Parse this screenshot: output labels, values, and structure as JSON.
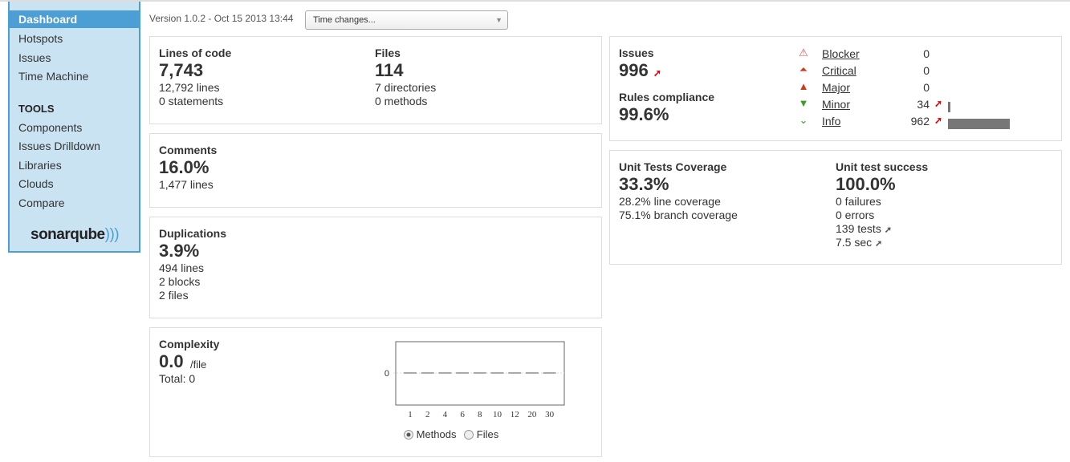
{
  "sidebar": {
    "items": [
      {
        "label": "Dashboard",
        "selected": true
      },
      {
        "label": "Hotspots"
      },
      {
        "label": "Issues"
      },
      {
        "label": "Time Machine"
      }
    ],
    "tools_heading": "TOOLS",
    "tools": [
      {
        "label": "Components"
      },
      {
        "label": "Issues Drilldown"
      },
      {
        "label": "Libraries"
      },
      {
        "label": "Clouds"
      },
      {
        "label": "Compare"
      }
    ],
    "logo": "sonarqube"
  },
  "header": {
    "version": "Version 1.0.2 - Oct 15 2013 13:44",
    "time_changes": "Time changes..."
  },
  "size": {
    "loc_label": "Lines of code",
    "loc": "7,743",
    "lines": "12,792 lines",
    "statements": "0 statements",
    "files_label": "Files",
    "files": "114",
    "directories": "7 directories",
    "methods": "0 methods"
  },
  "comments": {
    "label": "Comments",
    "value": "16.0%",
    "lines": "1,477 lines"
  },
  "duplications": {
    "label": "Duplications",
    "value": "3.9%",
    "lines": "494 lines",
    "blocks": "2 blocks",
    "files": "2 files"
  },
  "complexity": {
    "label": "Complexity",
    "value": "0.0",
    "unit": "/file",
    "total": "Total: 0",
    "radio_methods": "Methods",
    "radio_files": "Files",
    "selected": "Methods"
  },
  "chart_data": {
    "type": "bar",
    "categories": [
      "1",
      "2",
      "4",
      "6",
      "8",
      "10",
      "12",
      "20",
      "30"
    ],
    "values": [
      0,
      0,
      0,
      0,
      0,
      0,
      0,
      0,
      0
    ],
    "yticks": [
      "0"
    ]
  },
  "issues": {
    "label": "Issues",
    "value": "996",
    "compliance_label": "Rules compliance",
    "compliance": "99.6%",
    "severities": [
      {
        "name": "Blocker",
        "count": "0",
        "trend": false,
        "bar": 0,
        "icon": "blocker-icon",
        "color": "#d9534f"
      },
      {
        "name": "Critical",
        "count": "0",
        "trend": false,
        "bar": 0,
        "icon": "critical-icon",
        "color": "#d0391e"
      },
      {
        "name": "Major",
        "count": "0",
        "trend": false,
        "bar": 0,
        "icon": "major-icon",
        "color": "#d0391e"
      },
      {
        "name": "Minor",
        "count": "34",
        "trend": true,
        "bar": 0.035,
        "icon": "minor-icon",
        "color": "#3c9d2a"
      },
      {
        "name": "Info",
        "count": "962",
        "trend": true,
        "bar": 1,
        "icon": "info-icon",
        "color": "#3c9d2a"
      }
    ]
  },
  "coverage": {
    "label": "Unit Tests Coverage",
    "value": "33.3%",
    "line": "28.2% line coverage",
    "branch": "75.1% branch coverage",
    "success_label": "Unit test success",
    "success": "100.0%",
    "failures": "0 failures",
    "errors": "0 errors",
    "tests": "139 tests",
    "duration": "7.5 sec"
  }
}
